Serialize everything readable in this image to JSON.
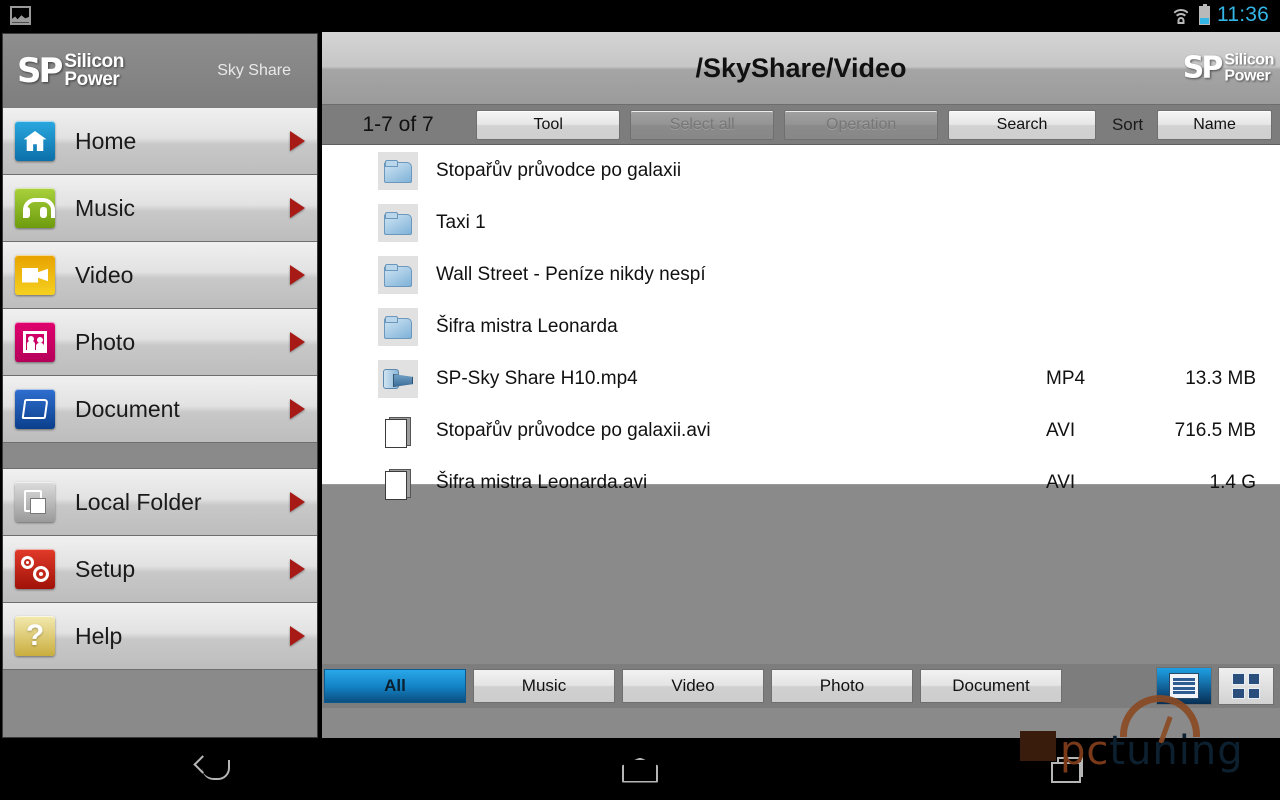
{
  "status_bar": {
    "app_icon": "gallery-icon",
    "wifi_icon": "wifi-icon",
    "battery_icon": "battery-icon",
    "time": "11:36",
    "time_color": "#33b5e5"
  },
  "sidebar": {
    "brand_mark": "SP",
    "brand_line1": "Silicon",
    "brand_line2": "Power",
    "subtitle": "Sky Share",
    "items": [
      {
        "label": "Home",
        "icon": "home-icon",
        "icon_class": "ic-home",
        "color": "#1b8fd0"
      },
      {
        "label": "Music",
        "icon": "headphones-icon",
        "icon_class": "ic-music",
        "color": "#8bbd22"
      },
      {
        "label": "Video",
        "icon": "camcorder-icon",
        "icon_class": "ic-video",
        "color": "#edb410"
      },
      {
        "label": "Photo",
        "icon": "people-photo-icon",
        "icon_class": "ic-photo",
        "color": "#d30068"
      },
      {
        "label": "Document",
        "icon": "folder-document-icon",
        "icon_class": "ic-doc",
        "color": "#1a55ae"
      }
    ],
    "items2": [
      {
        "label": "Local Folder",
        "icon": "clipboard-icon",
        "icon_class": "ic-local",
        "color": "#b8b8b8"
      },
      {
        "label": "Setup",
        "icon": "gears-icon",
        "icon_class": "ic-setup",
        "color": "#c42718"
      },
      {
        "label": "Help",
        "icon": "question-mark-icon",
        "icon_class": "ic-help",
        "color": "#d9c25c"
      }
    ]
  },
  "header": {
    "path": "/SkyShare/Video",
    "brand_mark": "SP",
    "brand_line1": "Silicon",
    "brand_line2": "Power"
  },
  "toolbar": {
    "count": "1-7 of 7",
    "tool": "Tool",
    "select_all": "Select all",
    "operation": "Operation",
    "search": "Search",
    "sort_label": "Sort",
    "sort_value": "Name"
  },
  "files": [
    {
      "name": "Stopařův průvodce po galaxii",
      "type": "",
      "size": "",
      "icon": "folder-icon",
      "icon_class": "folder"
    },
    {
      "name": "Taxi 1",
      "type": "",
      "size": "",
      "icon": "folder-icon",
      "icon_class": "folder"
    },
    {
      "name": "Wall Street - Peníze nikdy nespí",
      "type": "",
      "size": "",
      "icon": "folder-icon",
      "icon_class": "folder"
    },
    {
      "name": "Šifra mistra Leonarda",
      "type": "",
      "size": "",
      "icon": "folder-icon",
      "icon_class": "folder"
    },
    {
      "name": "SP-Sky Share H10.mp4",
      "type": "MP4",
      "size": "13.3 MB",
      "icon": "film-reel-icon",
      "icon_class": "film"
    },
    {
      "name": "Stopařův průvodce po galaxii.avi",
      "type": "AVI",
      "size": "716.5 MB",
      "icon": "document-pages-icon",
      "icon_class": "page"
    },
    {
      "name": "Šifra mistra Leonarda.avi",
      "type": "AVI",
      "size": "1.4 G",
      "icon": "document-pages-icon",
      "icon_class": "page"
    }
  ],
  "bottom_tabs": [
    {
      "label": "All",
      "active": true
    },
    {
      "label": "Music",
      "active": false
    },
    {
      "label": "Video",
      "active": false
    },
    {
      "label": "Photo",
      "active": false
    },
    {
      "label": "Document",
      "active": false
    }
  ],
  "view_modes": {
    "list": "list-view-icon",
    "grid": "grid-view-icon",
    "active": "list"
  },
  "watermark": {
    "text_part1": "pc",
    "text_part2": "tuning"
  },
  "navbar": {
    "back": "back-icon",
    "home": "home-icon",
    "recent": "recent-apps-icon"
  },
  "colors": {
    "accent_blue": "#1383c6",
    "status_blue": "#33b5e5",
    "panel_gray": "#8a8a8a",
    "arrow_red": "#a81a16"
  }
}
